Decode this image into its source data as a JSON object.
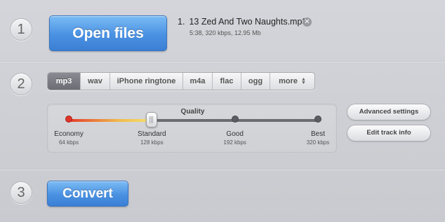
{
  "steps": {
    "one": "1",
    "two": "2",
    "three": "3"
  },
  "open_files": {
    "label": "Open files"
  },
  "file": {
    "index": "1.",
    "name": "13 Zed And Two Naughts.mp3",
    "meta": "5:38, 320 kbps, 12.95 Mb",
    "remove_glyph": "✕"
  },
  "formats": {
    "selected": "mp3",
    "tabs": [
      {
        "label": "mp3"
      },
      {
        "label": "wav"
      },
      {
        "label": "iPhone ringtone"
      },
      {
        "label": "m4a"
      },
      {
        "label": "flac"
      },
      {
        "label": "ogg"
      },
      {
        "label": "more"
      }
    ]
  },
  "quality": {
    "label": "Quality",
    "selected_index": 1,
    "levels": [
      {
        "name": "Economy",
        "rate": "64 kbps"
      },
      {
        "name": "Standard",
        "rate": "128 kbps"
      },
      {
        "name": "Good",
        "rate": "192 kbps"
      },
      {
        "name": "Best",
        "rate": "320 kbps"
      }
    ]
  },
  "buttons": {
    "advanced": "Advanced settings",
    "edit_track": "Edit track info",
    "convert": "Convert"
  },
  "colors": {
    "accent_blue": "#4a91e2",
    "selected_tab": "#6c6d74"
  }
}
